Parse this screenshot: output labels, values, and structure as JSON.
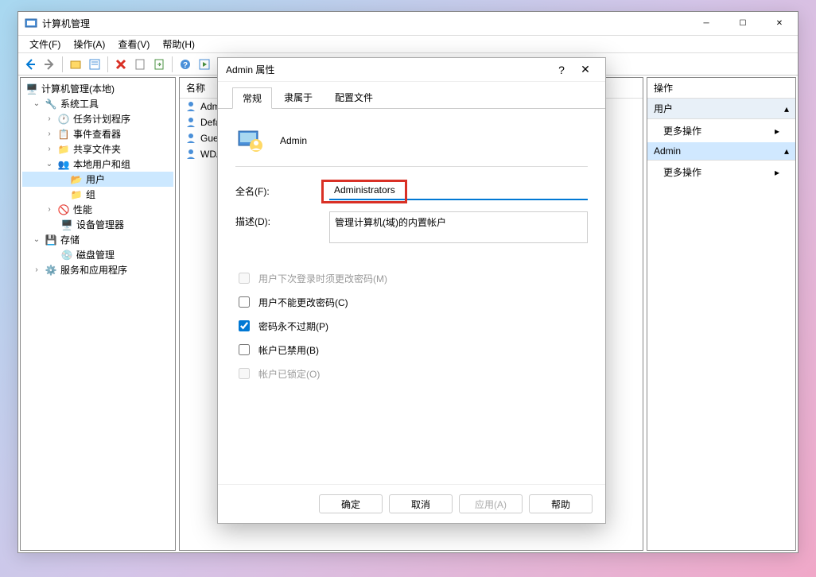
{
  "window": {
    "title": "计算机管理",
    "menu": [
      "文件(F)",
      "操作(A)",
      "查看(V)",
      "帮助(H)"
    ]
  },
  "tree": {
    "root": "计算机管理(本地)",
    "system_tools": "系统工具",
    "task_scheduler": "任务计划程序",
    "event_viewer": "事件查看器",
    "shared_folders": "共享文件夹",
    "local_users_groups": "本地用户和组",
    "users": "用户",
    "groups": "组",
    "performance": "性能",
    "device_manager": "设备管理器",
    "storage": "存储",
    "disk_management": "磁盘管理",
    "services_apps": "服务和应用程序"
  },
  "list": {
    "header_name": "名称",
    "items": [
      "Admin",
      "Defau",
      "Gues",
      "WDA"
    ]
  },
  "actions": {
    "header": "操作",
    "users_section": "用户",
    "more_actions": "更多操作",
    "admin_section": "Admin"
  },
  "dialog": {
    "title": "Admin 属性",
    "tabs": [
      "常规",
      "隶属于",
      "配置文件"
    ],
    "username": "Admin",
    "fullname_label": "全名(F):",
    "fullname_value": "Administrators",
    "description_label": "描述(D):",
    "description_value": "管理计算机(域)的内置帐户",
    "cb_change_pwd": "用户下次登录时须更改密码(M)",
    "cb_cannot_change": "用户不能更改密码(C)",
    "cb_never_expire": "密码永不过期(P)",
    "cb_disabled": "帐户已禁用(B)",
    "cb_locked": "帐户已锁定(O)",
    "btn_ok": "确定",
    "btn_cancel": "取消",
    "btn_apply": "应用(A)",
    "btn_help": "帮助"
  }
}
